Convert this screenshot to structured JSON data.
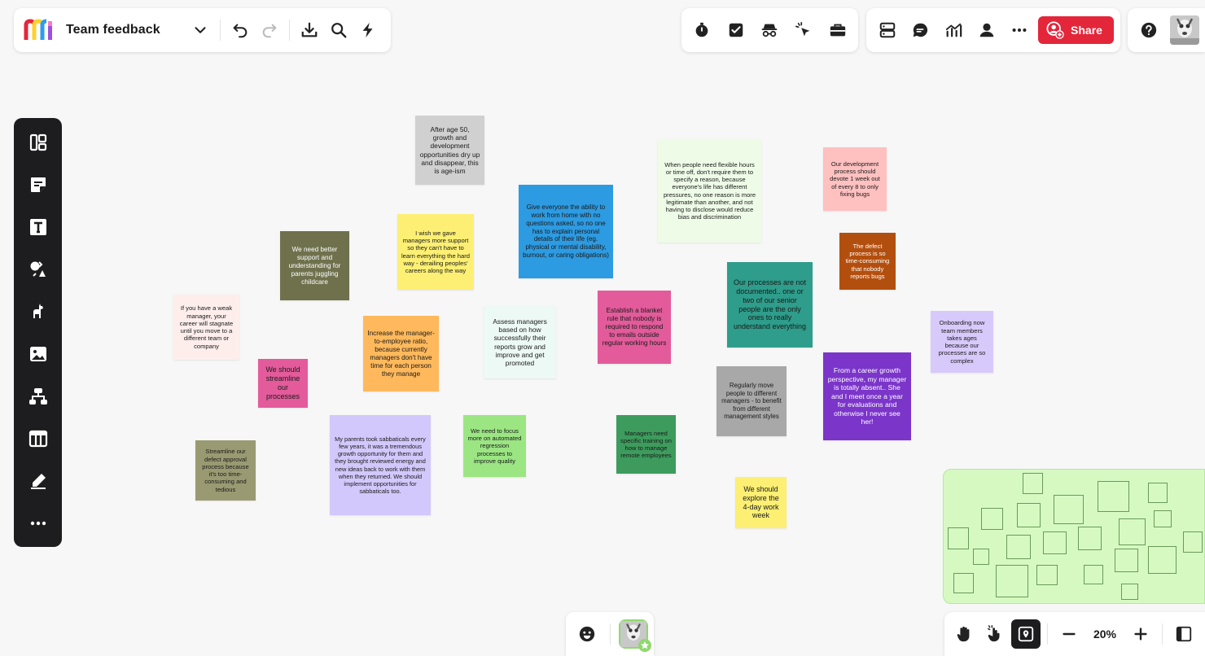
{
  "header": {
    "board_title": "Team feedback",
    "share_label": "Share"
  },
  "zoom": {
    "level": "20%"
  },
  "stickies": {
    "s1": "After age 50, growth and development opportunities dry up and disappear, this is age-ism",
    "s2": "Give everyone the ability to work from home with no questions asked, so no one has to explain personal details of their life (eg. physical or mental disability, burnout, or caring obligations)",
    "s3": "When people need flexible hours or time off, don't require them to specify a reason, because everyone's life has different pressures, no one reason is more legitimate than another, and not having to disclose would reduce bias and discrimination",
    "s4": "Our development process should devote 1 week out of every 8 to only fixing bugs",
    "s5": "I wish we gave managers more support so they can't have to learn everything the hard way - derailing peoples' careers along the way",
    "s6": "We need better support and understanding for parents juggling childcare",
    "s7": "The defect process is so time-consuming that nobody reports bugs",
    "s8": "Our processes are not documented.. one or two of our senior people are the only ones to really understand everything",
    "s9": "Establish a blanket rule that nobody is required to respond to emails outside regular working hours",
    "s10": "Onboarding now team members takes ages because our processes are so complex",
    "s11": "If you have a weak manager, your career will stagnate until you move to a different team or company",
    "s12": "Increase the manager-to-employee ratio, because currently managers don't have time for each person they manage",
    "s13": "Assess managers based on how successfully their reports grow and improve and get promoted",
    "s14": "From a career growth perspective, my manager is totally absent.. She and I meet once a year for evaluations and otherwise I never see her!",
    "s15": "We should streamline our processes",
    "s16": "Regularly move people to different managers - to benefit from different management styles",
    "s17": "My parents took sabbaticals every few years, it was a tremendous growth opportunity for them and they brought reviewed energy and new ideas back to work with them when they returned.  We should implement opportunities for sabbaticals too.",
    "s18": "We need to focus more on automated regression processes to improve quality",
    "s19": "Managers need specific training on how to manage remote employees",
    "s20": "Streamline our defect approval process because it's too time-consuming and tedious",
    "s21": "We should explore the 4-day work week"
  },
  "colors": {
    "share": "#e3263a",
    "minimap": "#d6f9c2",
    "toolbar": "#1d1d1f"
  },
  "icons": [
    "miro-logo-icon",
    "chevron-down-icon",
    "undo-icon",
    "redo-icon",
    "export-icon",
    "search-icon",
    "lightning-icon",
    "timer-icon",
    "checkbox-icon",
    "spy-icon",
    "cursor-click-icon",
    "toolbox-icon",
    "cards-icon",
    "comment-icon",
    "chart-icon",
    "user-icon",
    "more-icon",
    "help-icon",
    "board-icon",
    "sticky-note-icon",
    "text-icon",
    "shapes-icon",
    "llama-icon",
    "image-icon",
    "mindmap-icon",
    "table-icon",
    "pen-icon",
    "emoji-icon",
    "hand-icon",
    "hand-click-icon",
    "map-icon",
    "minus-icon",
    "plus-icon",
    "sidebar-icon"
  ]
}
